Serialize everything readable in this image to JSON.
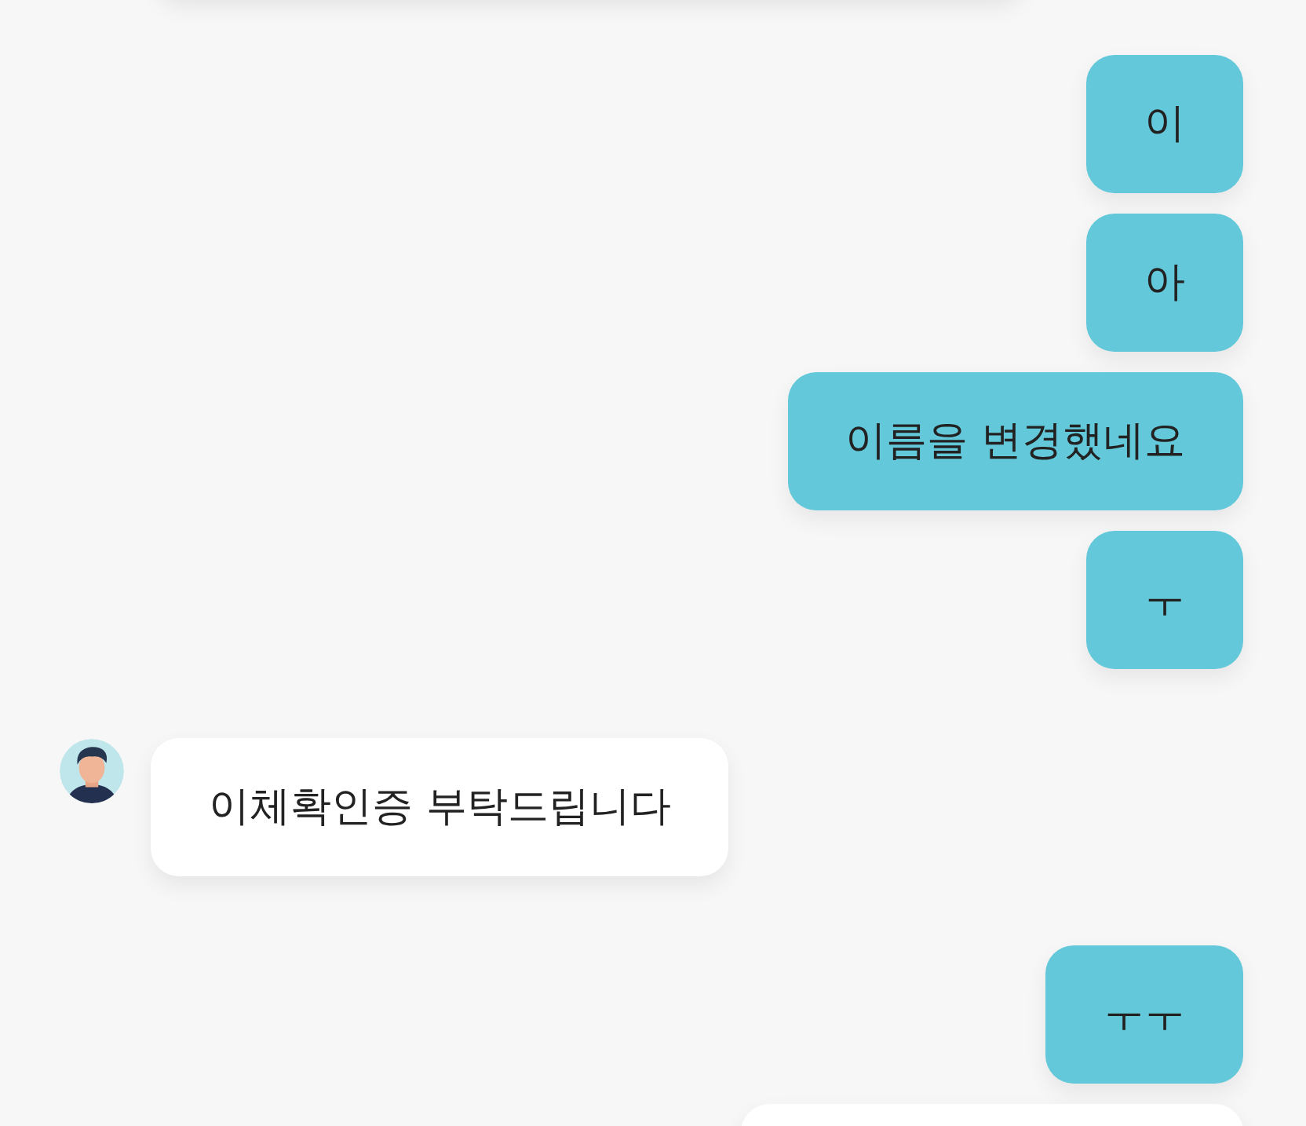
{
  "messages": [
    {
      "kind": "sent",
      "text": "이"
    },
    {
      "kind": "sent",
      "text": "아"
    },
    {
      "kind": "sent",
      "text": "이름을 변경했네요"
    },
    {
      "kind": "sent",
      "text": "ㅜ"
    },
    {
      "kind": "received",
      "text": "이체확인증 부탁드립니다",
      "avatar": true
    },
    {
      "kind": "sent",
      "text": "ㅜㅜ"
    },
    {
      "kind": "received-cut"
    }
  ]
}
